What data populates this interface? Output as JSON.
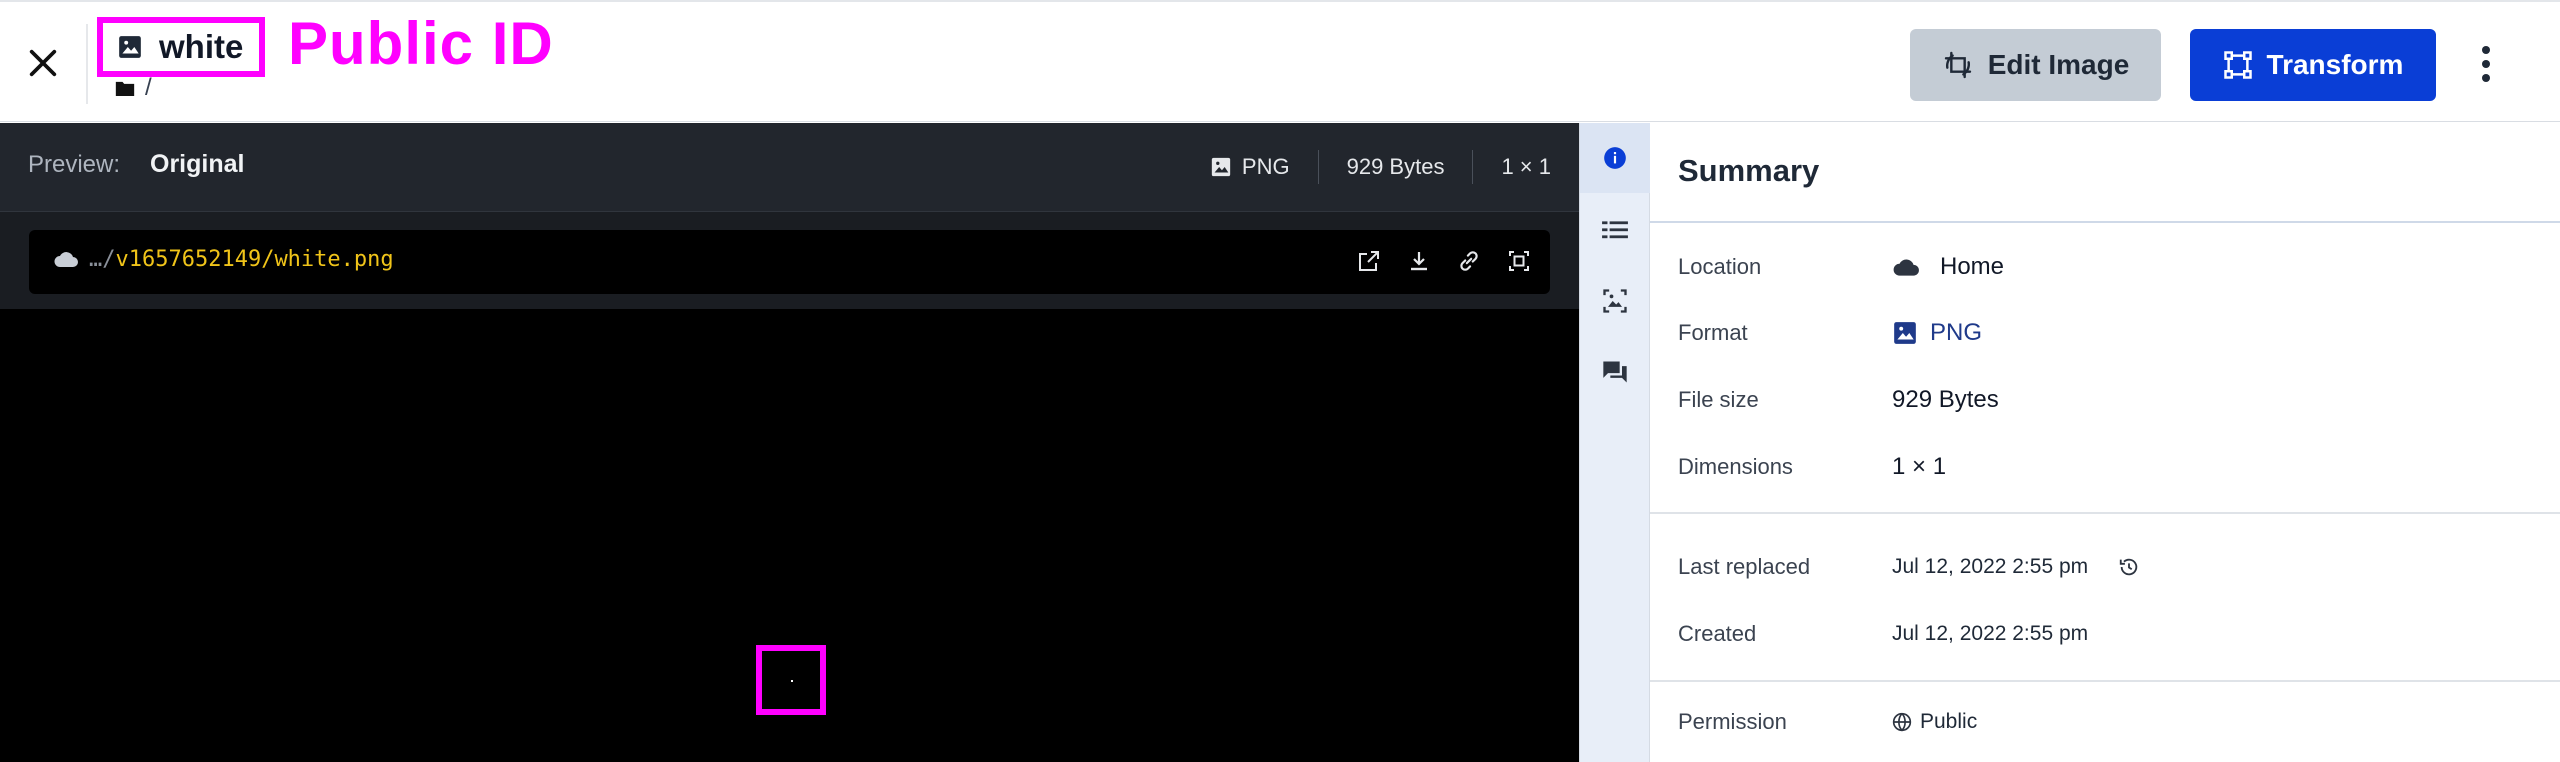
{
  "header": {
    "public_id": "white",
    "annotation_label": "Public ID",
    "folder_path": "/",
    "edit_label": "Edit Image",
    "transform_label": "Transform"
  },
  "preview": {
    "label": "Preview:",
    "value": "Original",
    "format": "PNG",
    "size": "929 Bytes",
    "dimensions": "1 × 1"
  },
  "url": {
    "prefix": "…/",
    "highlight": "v1657652149/white.png"
  },
  "side_tabs": [
    "info-icon",
    "list-icon",
    "image-analysis-icon",
    "comments-icon"
  ],
  "summary": {
    "title": "Summary",
    "rows": [
      {
        "label": "Location",
        "value": "Home"
      },
      {
        "label": "Format",
        "value": "PNG"
      },
      {
        "label": "File size",
        "value": "929 Bytes"
      },
      {
        "label": "Dimensions",
        "value": "1 × 1"
      },
      {
        "label": "Last replaced",
        "value": "Jul 12, 2022 2:55 pm"
      },
      {
        "label": "Created",
        "value": "Jul 12, 2022 2:55 pm"
      },
      {
        "label": "Permission",
        "value": "Public"
      }
    ]
  },
  "colors": {
    "brand_blue": "#0a3ed6",
    "annotation_magenta": "#ff00ff",
    "url_highlight": "#f0c419"
  }
}
